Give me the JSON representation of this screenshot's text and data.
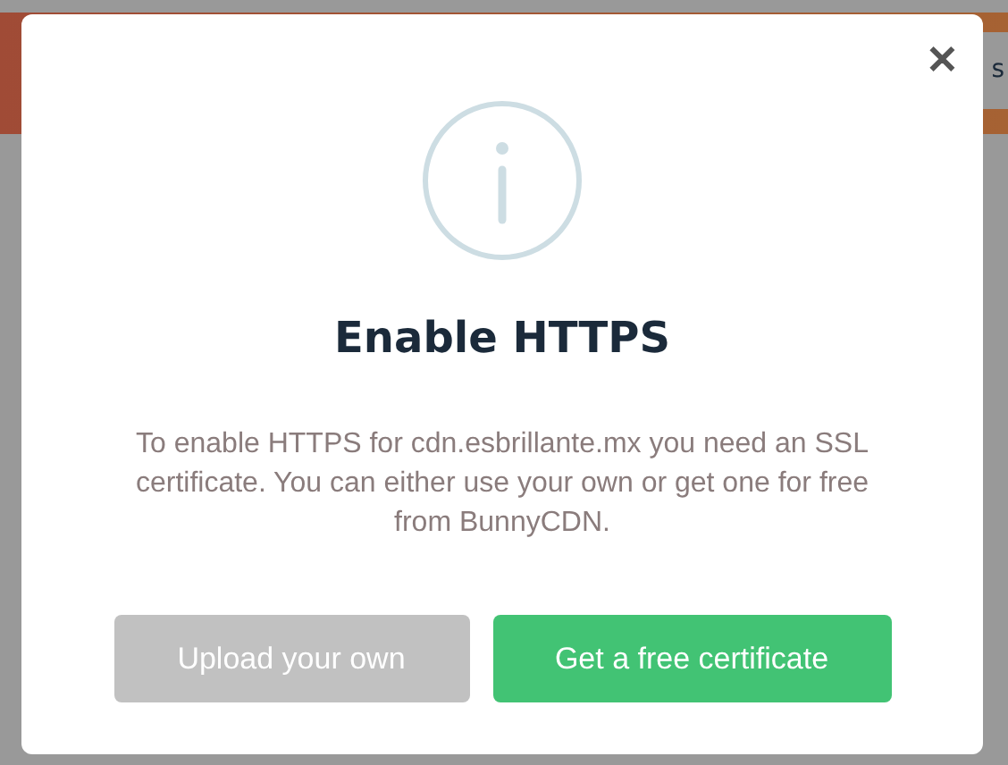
{
  "background": {
    "header_fragment": "s"
  },
  "dialog": {
    "close_label": "✕",
    "title": "Enable HTTPS",
    "message": "To enable HTTPS for cdn.esbrillante.mx you need an SSL certificate. You can either use your own or get one for free from BunnyCDN.",
    "buttons": [
      {
        "label": "Upload your own",
        "kind": "secondary"
      },
      {
        "label": "Get a free certificate",
        "kind": "primary"
      }
    ]
  }
}
